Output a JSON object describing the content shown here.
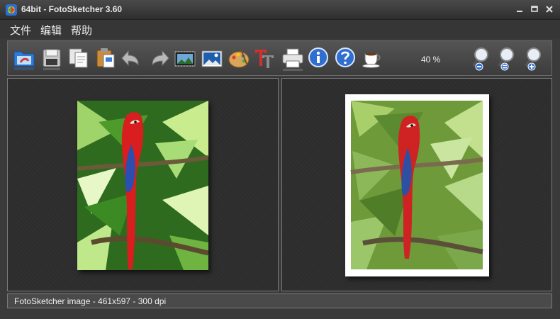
{
  "window": {
    "title": "64bit - FotoSketcher 3.60"
  },
  "menu": {
    "items": [
      "文件",
      "编辑",
      "帮助"
    ]
  },
  "toolbar": {
    "buttons": [
      {
        "name": "open-folder-icon"
      },
      {
        "name": "save-disk-icon"
      },
      {
        "name": "copy-icon"
      },
      {
        "name": "paste-clipboard-icon"
      },
      {
        "name": "undo-icon"
      },
      {
        "name": "redo-icon"
      },
      {
        "name": "batch-film-icon"
      },
      {
        "name": "image-params-icon"
      },
      {
        "name": "palette-icon"
      },
      {
        "name": "text-T-icon"
      },
      {
        "name": "printer-icon"
      },
      {
        "name": "info-icon"
      },
      {
        "name": "help-icon"
      },
      {
        "name": "coffee-cup-icon"
      },
      {
        "name": "zoom-out-icon"
      },
      {
        "name": "zoom-reset-icon"
      },
      {
        "name": "zoom-in-icon"
      }
    ],
    "zoom_level": "40 %"
  },
  "status": {
    "text": "FotoSketcher image - 461x597 - 300 dpi"
  }
}
